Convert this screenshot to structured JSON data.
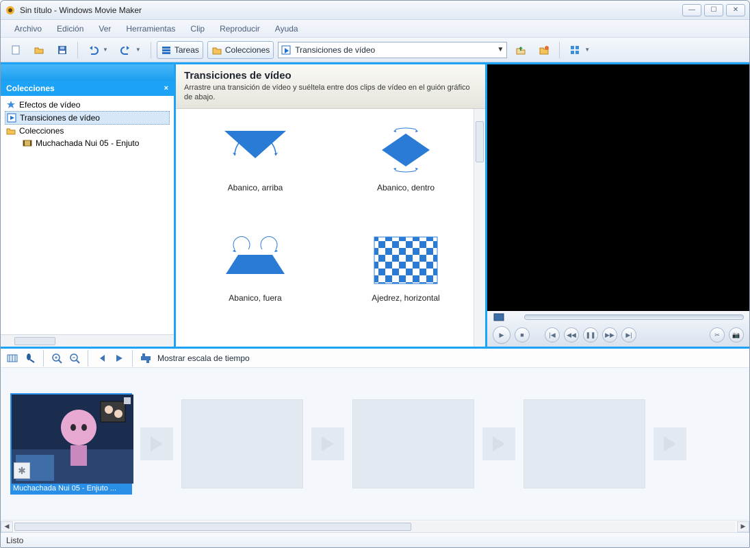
{
  "window": {
    "title": "Sin título - Windows Movie Maker"
  },
  "menu": {
    "items": [
      "Archivo",
      "Edición",
      "Ver",
      "Herramientas",
      "Clip",
      "Reproducir",
      "Ayuda"
    ]
  },
  "toolbar": {
    "tasks_label": "Tareas",
    "collections_label": "Colecciones",
    "location_value": "Transiciones de vídeo"
  },
  "sidebar": {
    "title": "Colecciones",
    "items": [
      {
        "label": "Efectos de vídeo",
        "icon": "star"
      },
      {
        "label": "Transiciones de vídeo",
        "icon": "play",
        "selected": true
      },
      {
        "label": "Colecciones",
        "icon": "folder"
      },
      {
        "label": "Muchachada Nui 05 - Enjuto",
        "icon": "film",
        "child": true
      }
    ]
  },
  "content": {
    "heading": "Transiciones de vídeo",
    "subheading": "Arrastre una transición de vídeo y suéltela entre dos clips de vídeo en el guión gráfico de abajo.",
    "items": [
      {
        "label": "Abanico, arriba",
        "shape": "fan_up"
      },
      {
        "label": "Abanico, dentro",
        "shape": "fan_in"
      },
      {
        "label": "Abanico, fuera",
        "shape": "fan_out"
      },
      {
        "label": "Ajedrez, horizontal",
        "shape": "checker"
      }
    ]
  },
  "bottom_toolbar": {
    "timeline_label": "Mostrar escala de tiempo"
  },
  "storyboard": {
    "clip1_caption": "Muchachada Nui 05 - Enjuto ..."
  },
  "status": {
    "text": "Listo"
  }
}
